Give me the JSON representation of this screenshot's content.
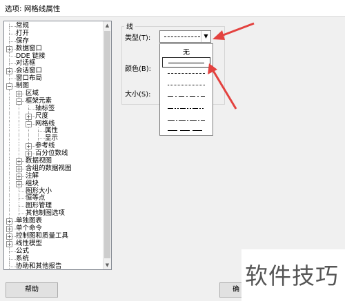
{
  "window": {
    "title": "选项: 网格线属性"
  },
  "tree": {
    "items": [
      {
        "label": "常规",
        "level": 0,
        "expander": "none"
      },
      {
        "label": "打开",
        "level": 0,
        "expander": "none"
      },
      {
        "label": "保存",
        "level": 0,
        "expander": "none"
      },
      {
        "label": "数据窗口",
        "level": 0,
        "expander": "plus"
      },
      {
        "label": "DDE 链接",
        "level": 0,
        "expander": "none"
      },
      {
        "label": "对话框",
        "level": 0,
        "expander": "none"
      },
      {
        "label": "会话窗口",
        "level": 0,
        "expander": "plus"
      },
      {
        "label": "窗口布局",
        "level": 0,
        "expander": "none"
      },
      {
        "label": "制图",
        "level": 0,
        "expander": "minus"
      },
      {
        "label": "区域",
        "level": 1,
        "expander": "plus"
      },
      {
        "label": "框架元素",
        "level": 1,
        "expander": "minus"
      },
      {
        "label": "轴标签",
        "level": 2,
        "expander": "none"
      },
      {
        "label": "尺度",
        "level": 2,
        "expander": "plus"
      },
      {
        "label": "网格线",
        "level": 2,
        "expander": "minus"
      },
      {
        "label": "属性",
        "level": 3,
        "expander": "none"
      },
      {
        "label": "显示",
        "level": 3,
        "expander": "none"
      },
      {
        "label": "参考线",
        "level": 2,
        "expander": "plus"
      },
      {
        "label": "百分位数线",
        "level": 2,
        "expander": "plus"
      },
      {
        "label": "数据视图",
        "level": 1,
        "expander": "plus"
      },
      {
        "label": "含组的数据视图",
        "level": 1,
        "expander": "plus"
      },
      {
        "label": "注解",
        "level": 1,
        "expander": "plus"
      },
      {
        "label": "组块",
        "level": 1,
        "expander": "plus"
      },
      {
        "label": "图形大小",
        "level": 1,
        "expander": "none"
      },
      {
        "label": "恒等点",
        "level": 1,
        "expander": "none"
      },
      {
        "label": "图形管理",
        "level": 1,
        "expander": "none"
      },
      {
        "label": "其他制图选项",
        "level": 1,
        "expander": "none"
      },
      {
        "label": "单独图表",
        "level": 0,
        "expander": "plus"
      },
      {
        "label": "单个命令",
        "level": 0,
        "expander": "plus"
      },
      {
        "label": "控制图和质量工具",
        "level": 0,
        "expander": "plus"
      },
      {
        "label": "线性模型",
        "level": 0,
        "expander": "plus"
      },
      {
        "label": "公式",
        "level": 0,
        "expander": "none"
      },
      {
        "label": "系统",
        "level": 0,
        "expander": "none"
      },
      {
        "label": "协助和其他报告",
        "level": 0,
        "expander": "none"
      }
    ]
  },
  "line_group": {
    "title": "线",
    "type_label": "类型(T):",
    "color_label": "颜色(B):",
    "size_label": "大小(S):"
  },
  "dropdown": {
    "none_label": "无",
    "options": [
      {
        "style": "solid",
        "selected": true
      },
      {
        "style": "long-dash"
      },
      {
        "style": "dotted"
      },
      {
        "style": "dash-dot"
      },
      {
        "style": "dash-dot-dot"
      },
      {
        "style": "dot-dash-long"
      },
      {
        "style": "long-dash-2"
      }
    ]
  },
  "buttons": {
    "help": "帮助",
    "ok": "确"
  },
  "watermark": "软件技巧",
  "colors": {
    "arrow": "#e3423f"
  }
}
